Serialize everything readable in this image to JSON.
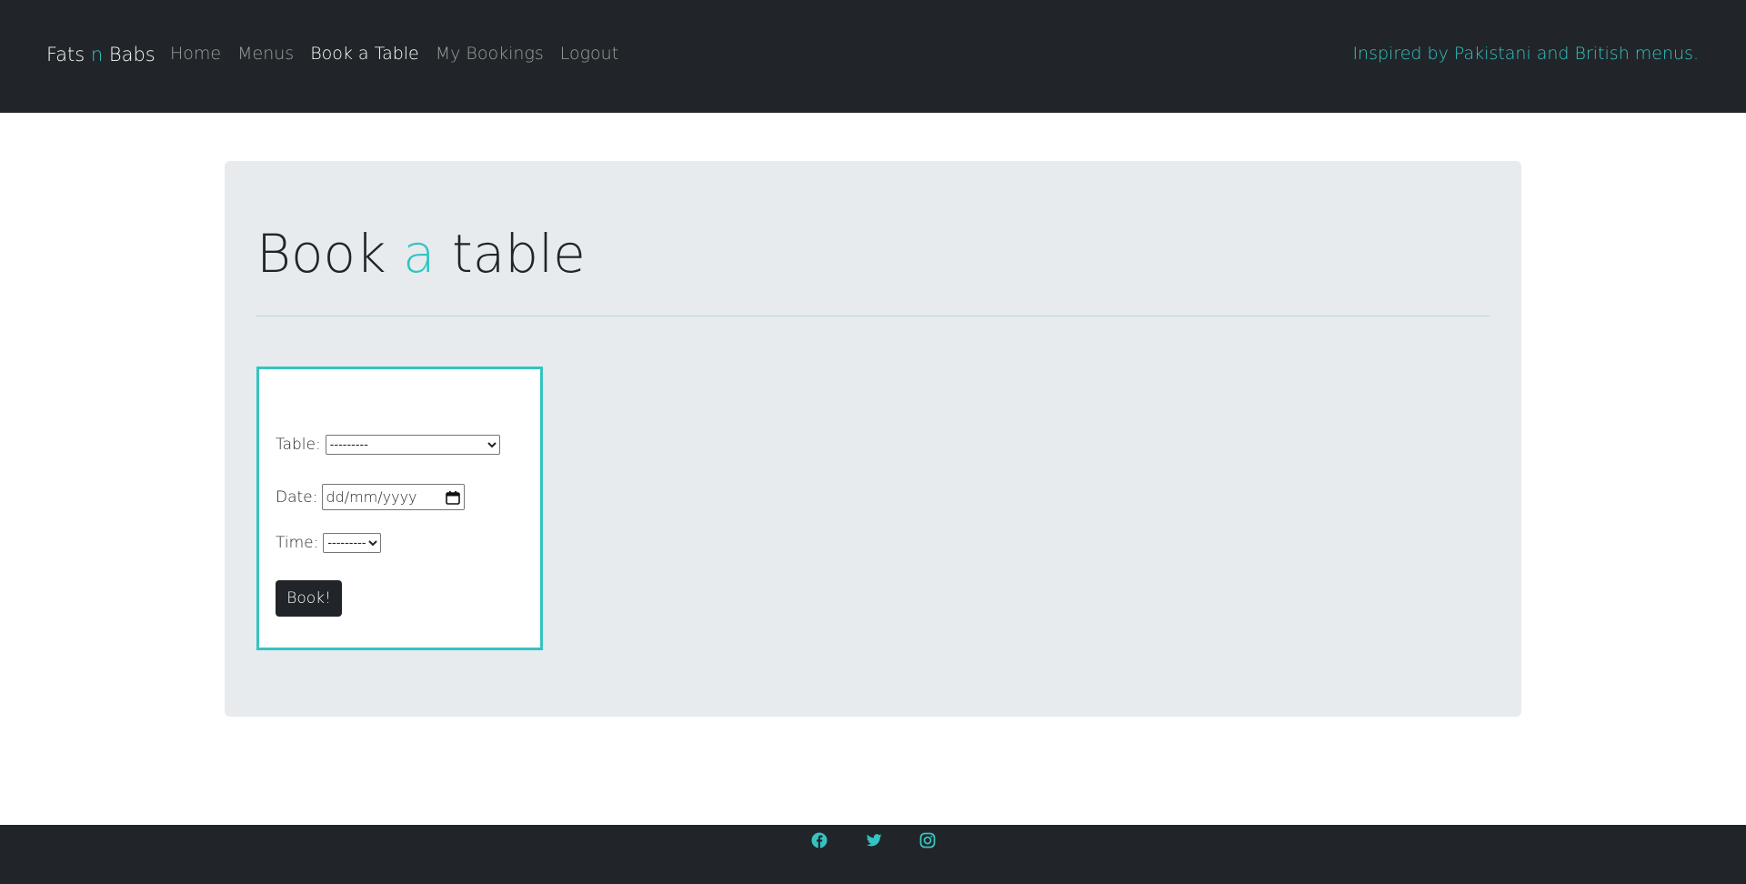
{
  "navbar": {
    "brand": {
      "part1": "Fats ",
      "accent": "n",
      "part2": " Babs"
    },
    "links": [
      {
        "label": "Home"
      },
      {
        "label": "Menus"
      },
      {
        "label": "Book a Table"
      },
      {
        "label": "My Bookings"
      },
      {
        "label": "Logout"
      }
    ],
    "tagline": "Inspired by Pakistani and British menus."
  },
  "page": {
    "title": {
      "part1": "Book ",
      "accent": "a",
      "part2": " table"
    }
  },
  "form": {
    "table_label": "Table:",
    "table_value": "---------",
    "date_label": "Date:",
    "date_placeholder": "dd/mm/yyyy",
    "time_label": "Time:",
    "time_value": "---------",
    "submit_label": "Book!"
  },
  "footer": {
    "icons": [
      "facebook-icon",
      "twitter-icon",
      "instagram-icon"
    ]
  },
  "colors": {
    "accent": "#35c3c1",
    "dark": "#212529",
    "card_bg": "#e7ebee"
  }
}
